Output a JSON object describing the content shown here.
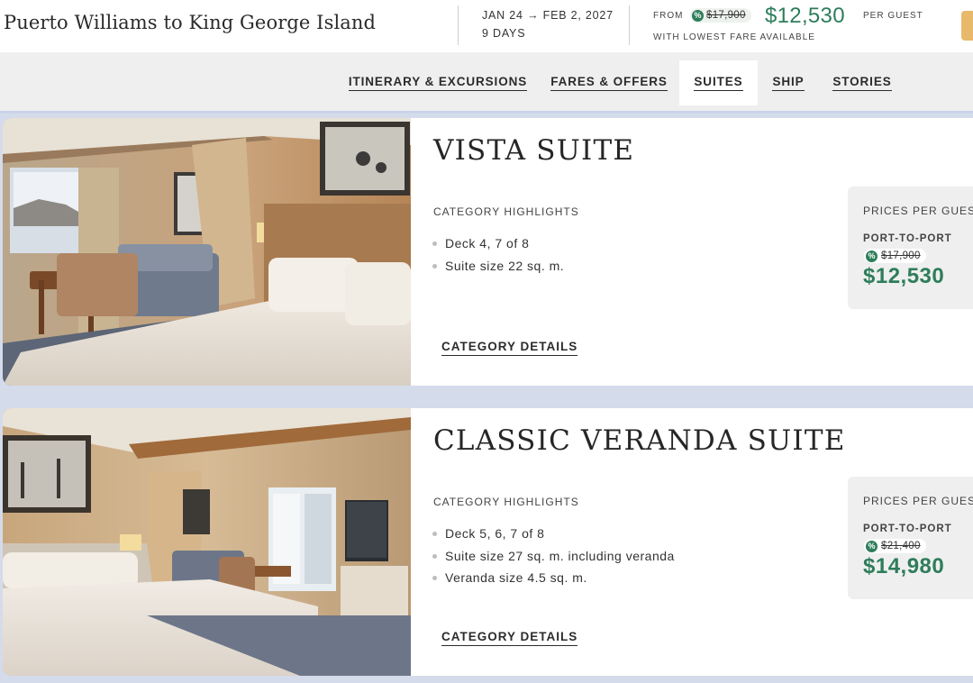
{
  "header": {
    "title": "Puerto Williams to King George Island",
    "dates": "JAN 24 → FEB 2, 2027",
    "duration": "9 DAYS",
    "from_label": "FROM",
    "old_price": "$17,900",
    "price": "$12,530",
    "per_guest": "PER GUEST",
    "fare_note": "WITH LOWEST FARE AVAILABLE"
  },
  "nav": {
    "items": [
      {
        "label": "ITINERARY & EXCURSIONS"
      },
      {
        "label": "FARES & OFFERS"
      },
      {
        "label": "SUITES"
      },
      {
        "label": "SHIP"
      },
      {
        "label": "STORIES"
      }
    ],
    "active": "SUITES"
  },
  "suites": [
    {
      "name": "VISTA SUITE",
      "highlights_label": "CATEGORY HIGHLIGHTS",
      "highlights": [
        "Deck 4, 7 of 8",
        "Suite size 22 sq. m."
      ],
      "details_label": "CATEGORY DETAILS",
      "prices_label": "PRICES PER GUEST",
      "fare_type": "PORT-TO-PORT",
      "old_price": "$17,900",
      "price": "$12,530"
    },
    {
      "name": "CLASSIC VERANDA SUITE",
      "highlights_label": "CATEGORY HIGHLIGHTS",
      "highlights": [
        "Deck 5, 6, 7 of 8",
        "Suite size 27 sq. m. including veranda",
        "Veranda size 4.5 sq. m."
      ],
      "details_label": "CATEGORY DETAILS",
      "prices_label": "PRICES PER GUEST",
      "fare_type": "PORT-TO-PORT",
      "old_price": "$21,400",
      "price": "$14,980"
    }
  ],
  "icons": {
    "discount": "percent-badge-icon",
    "pct_glyph": "%"
  },
  "colors": {
    "price_green": "#2e7d5b",
    "accent_button": "#e8b96a",
    "page_background": "#d4dbeb"
  }
}
